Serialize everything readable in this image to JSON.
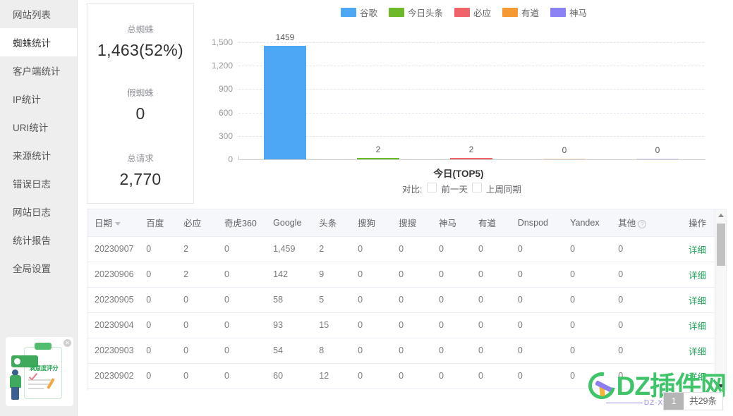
{
  "sidebar": {
    "items": [
      {
        "label": "网站列表",
        "active": false
      },
      {
        "label": "蜘蛛统计",
        "active": true
      },
      {
        "label": "客户端统计",
        "active": false
      },
      {
        "label": "IP统计",
        "active": false
      },
      {
        "label": "URI统计",
        "active": false
      },
      {
        "label": "来源统计",
        "active": false
      },
      {
        "label": "错误日志",
        "active": false
      },
      {
        "label": "网站日志",
        "active": false
      },
      {
        "label": "统计报告",
        "active": false
      },
      {
        "label": "全局设置",
        "active": false
      }
    ]
  },
  "satisfaction_widget": {
    "title": "满意度评分",
    "close_label": "✕"
  },
  "stats": [
    {
      "label": "总蜘蛛",
      "value": "1,463(52%)"
    },
    {
      "label": "假蜘蛛",
      "value": "0"
    },
    {
      "label": "总请求",
      "value": "2,770"
    }
  ],
  "chart_data": {
    "type": "bar",
    "title": "",
    "xlabel": "今日(TOP5)",
    "ylabel": "",
    "categories": [
      "谷歌",
      "今日头条",
      "必应",
      "有道",
      "神马"
    ],
    "values": [
      1459,
      2,
      2,
      0,
      0
    ],
    "colors": [
      "#4ea7f5",
      "#6cb92a",
      "#f0636a",
      "#f59a32",
      "#8b83f5"
    ],
    "ylim": [
      0,
      1500
    ],
    "yticks": [
      "0",
      "300",
      "600",
      "900",
      "1,200",
      "1,500"
    ],
    "ytick_values": [
      0,
      300,
      600,
      900,
      1200,
      1500
    ],
    "grid": true,
    "legend_position": "top",
    "legend": [
      {
        "label": "谷歌",
        "color": "#4ea7f5"
      },
      {
        "label": "今日头条",
        "color": "#6cb92a"
      },
      {
        "label": "必应",
        "color": "#f0636a"
      },
      {
        "label": "有道",
        "color": "#f59a32"
      },
      {
        "label": "神马",
        "color": "#8b83f5"
      }
    ],
    "data_labels": [
      "1459",
      "2",
      "2",
      "0",
      "0"
    ]
  },
  "compare": {
    "label": "对比:",
    "options": [
      {
        "label": "前一天",
        "checked": false
      },
      {
        "label": "上周同期",
        "checked": false
      }
    ]
  },
  "table": {
    "columns": [
      "日期",
      "百度",
      "必应",
      "奇虎360",
      "Google",
      "头条",
      "搜狗",
      "搜搜",
      "神马",
      "有道",
      "Dnspod",
      "Yandex",
      "其他",
      "操作"
    ],
    "help_column": "其他",
    "sort_column": "日期",
    "detail_label": "详细",
    "rows": [
      {
        "cells": [
          "20230907",
          "0",
          "2",
          "0",
          "1,459",
          "2",
          "0",
          "0",
          "0",
          "0",
          "0",
          "0",
          "0"
        ]
      },
      {
        "cells": [
          "20230906",
          "0",
          "2",
          "0",
          "142",
          "9",
          "0",
          "0",
          "0",
          "0",
          "0",
          "0",
          "0"
        ]
      },
      {
        "cells": [
          "20230905",
          "0",
          "0",
          "0",
          "58",
          "5",
          "0",
          "0",
          "0",
          "0",
          "0",
          "0",
          "0"
        ]
      },
      {
        "cells": [
          "20230904",
          "0",
          "0",
          "0",
          "93",
          "15",
          "0",
          "0",
          "0",
          "0",
          "0",
          "0",
          "0"
        ]
      },
      {
        "cells": [
          "20230903",
          "0",
          "0",
          "0",
          "54",
          "8",
          "0",
          "0",
          "0",
          "0",
          "0",
          "0",
          "0"
        ]
      },
      {
        "cells": [
          "20230902",
          "0",
          "0",
          "0",
          "60",
          "12",
          "0",
          "0",
          "0",
          "0",
          "0",
          "0",
          "0"
        ]
      }
    ]
  },
  "pagination": {
    "current_page": "1",
    "total_text": "共29条"
  },
  "watermark": {
    "text": "DZ插件网",
    "sub_text": "DZ-X.NET"
  }
}
